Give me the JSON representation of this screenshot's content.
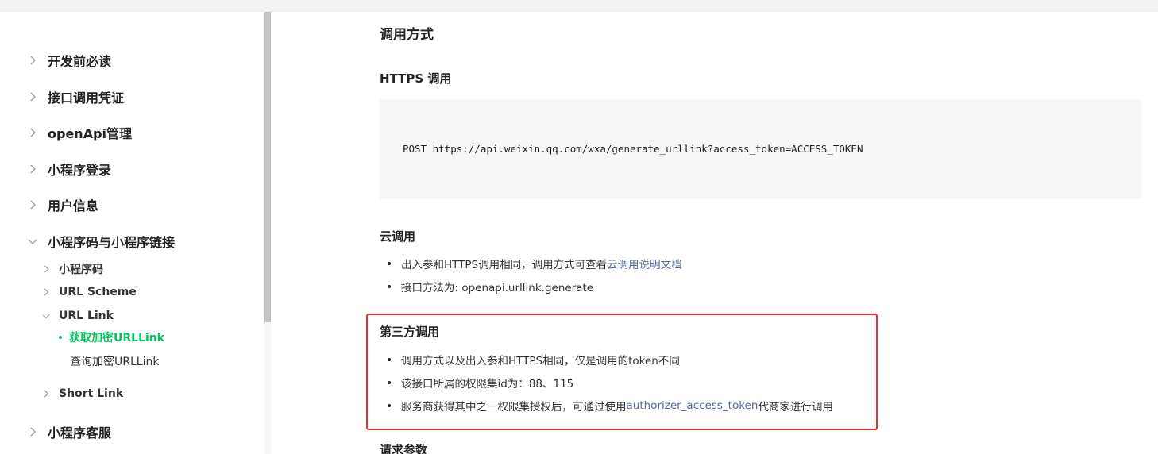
{
  "sidebar": {
    "items": [
      {
        "label": "开发前必读",
        "chevron": "chevron-right-icon"
      },
      {
        "label": "接口调用凭证",
        "chevron": "chevron-right-icon"
      },
      {
        "label": "openApi管理",
        "chevron": "chevron-right-icon"
      },
      {
        "label": "小程序登录",
        "chevron": "chevron-right-icon"
      },
      {
        "label": "用户信息",
        "chevron": "chevron-right-icon"
      },
      {
        "label": "小程序码与小程序链接",
        "chevron": "chevron-down-icon"
      },
      {
        "label": "小程序客服",
        "chevron": "chevron-right-icon"
      }
    ],
    "sub_items": [
      {
        "label": "小程序码",
        "chevron": "chevron-right-icon"
      },
      {
        "label": "URL Scheme",
        "chevron": "chevron-right-icon"
      },
      {
        "label": "URL Link",
        "chevron": "chevron-down-icon"
      },
      {
        "label": "Short Link",
        "chevron": "chevron-right-icon"
      }
    ],
    "leaf_items": [
      {
        "label": "获取加密URLLink",
        "active": true
      },
      {
        "label": "查询加密URLLink",
        "active": false
      }
    ]
  },
  "main": {
    "title": "调用方式",
    "https_heading": "HTTPS 调用",
    "code": "POST https://api.weixin.qq.com/wxa/generate_urllink?access_token=ACCESS_TOKEN",
    "cloud_heading": "云调用",
    "cloud_bullets": {
      "b1_text": "出入参和HTTPS调用相同，调用方式可查看",
      "b1_link": "云调用说明文档",
      "b2_text": "接口方法为: openapi.urllink.generate"
    },
    "third_heading": "第三方调用",
    "third_bullets": {
      "b1_text": "调用方式以及出入参和HTTPS相同，仅是调用的token不同",
      "b2_text": "该接口所属的权限集id为：88、115",
      "b3_pre": "服务商获得其中之一权限集授权后，可通过使用",
      "b3_link": "authorizer_access_token",
      "b3_post": "代商家进行调用"
    },
    "next_heading": "请求参数"
  },
  "colors": {
    "accent_active": "#07c160",
    "link": "#576b95",
    "highlight_border": "#e8342f",
    "code_bg": "#f7f7f7"
  }
}
